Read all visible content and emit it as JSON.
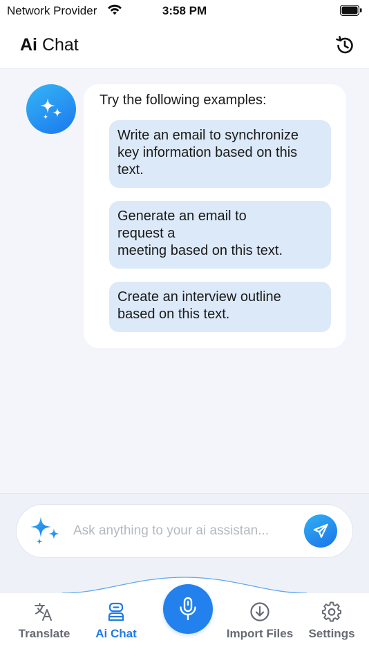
{
  "status_bar": {
    "carrier": "Network Provider",
    "time": "3:58 PM"
  },
  "header": {
    "title_bold": "Ai",
    "title_rest": " Chat"
  },
  "chat": {
    "intro": "Try the following examples:",
    "examples": [
      "Write an email to synchronize\nkey information based on this\ntext.",
      "Generate an email to\nrequest a\nmeeting based on this text.",
      "Create an interview outline\nbased on this text."
    ]
  },
  "input": {
    "placeholder": "Ask anything to your ai assistan...",
    "value": ""
  },
  "tabs": [
    {
      "label": "Translate",
      "icon": "translate-icon",
      "active": false
    },
    {
      "label": "Ai Chat",
      "icon": "robot-icon",
      "active": true
    },
    {
      "label": "Import Files",
      "icon": "download-icon",
      "active": false
    },
    {
      "label": "Settings",
      "icon": "gear-icon",
      "active": false
    }
  ],
  "colors": {
    "accent": "#1e7be9",
    "example_bubble": "#dce9f8",
    "background": "#f3f5fa",
    "inactive_tab": "#666b73"
  }
}
